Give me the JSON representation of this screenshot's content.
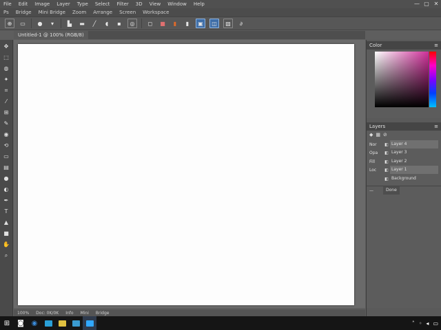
{
  "menubar": {
    "items": [
      "File",
      "Edit",
      "Image",
      "Layer",
      "Type",
      "Select",
      "Filter",
      "3D",
      "View",
      "Window",
      "Help"
    ]
  },
  "window_controls": {
    "minimize": "—",
    "maximize": "▢",
    "close": "✕"
  },
  "menubar2": {
    "items": [
      "Ps",
      "Bridge",
      "Mini Bridge",
      "Zoom",
      "Arrange",
      "Screen",
      "Workspace"
    ]
  },
  "options_bar": {
    "icons": [
      "move-icon",
      "marquee-icon",
      "lasso-icon",
      "crop-icon",
      "brush-icon",
      "eraser-icon",
      "gradient-icon",
      "pen-icon",
      "type-icon",
      "shape-icon",
      "zoom-icon",
      "hand-icon",
      "stop-icon",
      "fill-icon",
      "align-icon",
      "distribute-icon",
      "transform-icon",
      "warp-icon"
    ]
  },
  "doc_tab": {
    "label": "Untitled-1 @ 100% (RGB/8)"
  },
  "status_bar": {
    "items": [
      "100%",
      "Doc: 0K/0K",
      "Info",
      "Mini",
      "Bridge"
    ]
  },
  "color_panel": {
    "title": "Color",
    "field_hue": "#d0309a"
  },
  "layers_panel": {
    "title": "Layers",
    "rows": [
      {
        "tag": "Nor",
        "name": "Layer 4",
        "highlight": true
      },
      {
        "tag": "Opa",
        "name": "Layer 3",
        "highlight": false
      },
      {
        "tag": "Fill",
        "name": "Layer 2",
        "highlight": false
      },
      {
        "tag": "Loc",
        "name": "Layer 1",
        "highlight": true
      },
      {
        "tag": "",
        "name": "Background",
        "highlight": false
      }
    ],
    "footer": "Done"
  },
  "colors": {
    "accent": "#3e6ea8",
    "canvas": "#fdfdfd",
    "chrome": "#5e5e5e",
    "taskbar": "#151515"
  },
  "taskbar": {
    "icons": [
      "windows-icon",
      "search-icon",
      "browser-icon",
      "folder-icon",
      "app-icon",
      "app-icon-2",
      "photoshop-icon"
    ]
  },
  "tray": {
    "icons": [
      "chevron-up-icon",
      "network-icon",
      "volume-icon",
      "notification-icon"
    ]
  }
}
